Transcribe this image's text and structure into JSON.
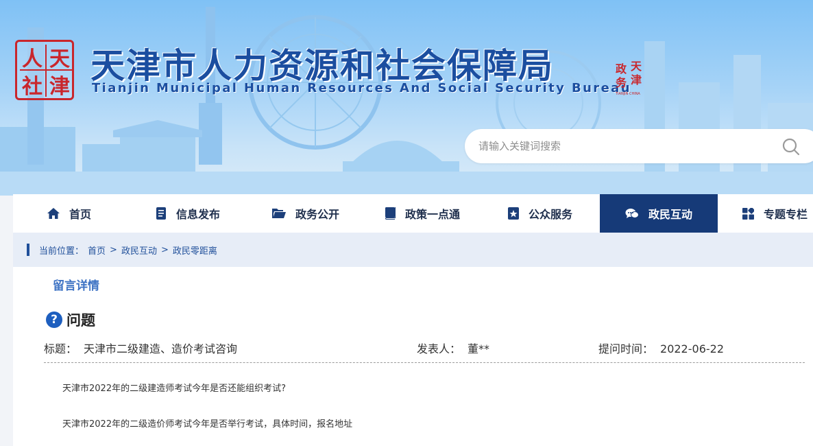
{
  "header": {
    "seal_chars": [
      "人",
      "天",
      "社",
      "津"
    ],
    "title_cn": "天津市人力资源和社会保障局",
    "title_en": "Tianjin Municipal Human Resources And Social Security Bureau",
    "emblem_chars": [
      "天",
      "津",
      "政",
      "务"
    ],
    "emblem_sub": "TIANJIN CHINA"
  },
  "search": {
    "placeholder": "请输入关键词搜索",
    "icon": "search-icon"
  },
  "nav": {
    "items": [
      {
        "label": "首页",
        "icon": "home-icon"
      },
      {
        "label": "信息发布",
        "icon": "document-icon"
      },
      {
        "label": "政务公开",
        "icon": "folder-icon"
      },
      {
        "label": "政策一点通",
        "icon": "book-icon"
      },
      {
        "label": "公众服务",
        "icon": "star-bookmark-icon"
      },
      {
        "label": "政民互动",
        "icon": "chat-icon",
        "active": true
      },
      {
        "label": "专题专栏",
        "icon": "grid-icon"
      }
    ]
  },
  "breadcrumb": {
    "prefix": "当前位置：",
    "items": [
      "首页",
      "政民互动",
      "政民零距离"
    ],
    "separator": ">"
  },
  "detail": {
    "section_title": "留言详情",
    "question_heading": "问题",
    "title_label": "标题：",
    "title_value": "天津市二级建造、造价考试咨询",
    "author_label": "发表人：",
    "author_value": "董**",
    "time_label": "提问时间：",
    "time_value": "2022-06-22",
    "paragraphs": [
      "天津市2022年的二级建造师考试今年是否还能组织考试?",
      "天津市2022年的二级造价师考试今年是否举行考试，具体时间，报名地址"
    ]
  },
  "colors": {
    "brand_blue": "#1b4ea0",
    "nav_active": "#163a78",
    "seal_red": "#c9262c",
    "section_blue": "#3e73c4"
  }
}
